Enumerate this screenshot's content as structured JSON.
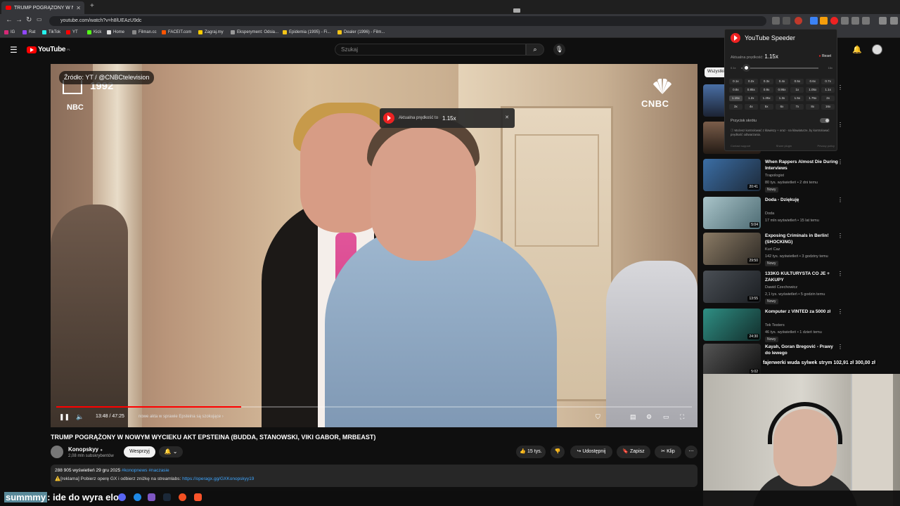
{
  "browser": {
    "tab_title": "TRUMP POGRĄŻONY W NO...",
    "url": "youtube.com/watch?v=h8lUEAzU9dc",
    "bookmarks": [
      {
        "label": "IG",
        "color": "#d62976"
      },
      {
        "label": "Rat",
        "color": "#9146ff"
      },
      {
        "label": "TikTok",
        "color": "#25f4ee"
      },
      {
        "label": "YT",
        "color": "#ff0000"
      },
      {
        "label": "Kick",
        "color": "#53fc18"
      },
      {
        "label": "Home",
        "color": "#dddddd"
      },
      {
        "label": "Filman.cc",
        "color": "#888888"
      },
      {
        "label": "FACEIT.com",
        "color": "#ff5500"
      },
      {
        "label": "Zagraj.my",
        "color": "#ffcc00"
      },
      {
        "label": "Eksperyment: Odsia...",
        "color": "#999999"
      },
      {
        "label": "Epidemia (1995) - Fi...",
        "color": "#f5c518"
      },
      {
        "label": "Dealer (1996) - Film...",
        "color": "#f5c518"
      }
    ]
  },
  "yt_header": {
    "logo": "YouTube",
    "region": "PL",
    "search_placeholder": "Szukaj"
  },
  "video": {
    "source_badge": "Źródło: YT / @CNBCtelevision",
    "year_overlay": "1992",
    "network_left": "NBC",
    "network_right": "CNBC",
    "speed_toast_label": "Aktualna prędkość to",
    "speed_toast_value": "1.15x",
    "time": "13:48 / 47:25",
    "chapter": "nowe akta w sprawie Epsteina są szokujące",
    "progress": 0.291
  },
  "meta": {
    "title": "TRUMP POGRĄŻONY W NOWYM WYCIEKU AKT EPSTEINA (BUDDA, STANOWSKI, VIKI GABOR, MRBEAST)",
    "channel": "Konopskyy",
    "subs": "2,08 mln subskrybentów",
    "support": "Wesprzyj",
    "likes": "15 tys.",
    "share": "Udostępnij",
    "save": "Zapisz",
    "clip": "Klip",
    "views_date": "288 905 wyświetleń  29 gru 2025",
    "hashtags": "#konopnews #naczasie",
    "desc_line": "⚠️[reklama] Pobierz operę GX i odbierz zniżkę na streamlabs:",
    "desc_link": "https://operagx.gg/GXKonopskyy19"
  },
  "sidebar": {
    "chip": "Wszystkie",
    "recs": [
      {
        "title": "When Rappers Almost Die During Interviews",
        "channel": "Trapologist",
        "meta": "80 tys. wyświetleń • 2 dni temu",
        "duration": "20:41",
        "new": "Nowy",
        "color1": "#3b6ea5",
        "color2": "#1d2a3a"
      },
      {
        "title": "Doda - Dziękuję",
        "channel": "Doda",
        "meta": "17 mln wyświetleń • 15 lat temu",
        "duration": "5:04",
        "new": "",
        "color1": "#a9c4c9",
        "color2": "#4d6b73"
      },
      {
        "title": "Exposing Criminals in Berlin! (SHOCKING)",
        "channel": "Kurt Caz",
        "meta": "142 tys. wyświetleń • 3 godziny temu",
        "duration": "29:50",
        "new": "Nowy",
        "color1": "#8b7b65",
        "color2": "#2e2a25"
      },
      {
        "title": "133KG KULTURYSTA CO JE + ZAKUPY",
        "channel": "Dawid Czechowicz",
        "meta": "2,1 tys. wyświetleń • 5 godzin temu",
        "duration": "13:55",
        "new": "Nowy",
        "color1": "#4a4f55",
        "color2": "#1b1e22"
      },
      {
        "title": "Komputer z VINTED za 5000 zł",
        "channel": "Tek Testers",
        "meta": "46 tys. wyświetleń • 1 dzień temu",
        "duration": "24:30",
        "new": "Nowy",
        "color1": "#2f8f84",
        "color2": "#122d2b"
      },
      {
        "title": "Kayah, Goran Bregović - Prawy do lewego",
        "channel": "",
        "meta": "",
        "duration": "5:02",
        "new": "",
        "color1": "#555555",
        "color2": "#111111"
      }
    ]
  },
  "extension": {
    "title": "YouTube Speeder",
    "current_label": "Aktualna prędkość:",
    "current_value": "1.15x",
    "reset": "Reset",
    "min": "0.1x",
    "max": "16x",
    "speed_value": 1.15,
    "presets": [
      "0.1x",
      "0.2x",
      "0.3x",
      "0.4x",
      "0.5x",
      "0.6x",
      "0.7x",
      "0.8x",
      "0.85x",
      "0.9x",
      "0.95x",
      "1x",
      "1.05x",
      "1.1x",
      "1.15x",
      "1.2x",
      "1.25x",
      "1.3x",
      "1.5x",
      "1.75x",
      "2x",
      "3x",
      "4x",
      "5x",
      "6x",
      "7x",
      "8x",
      "16x"
    ],
    "shortcut": "Przycisk skrótu",
    "info": "Możesz kontrolować z klawiszy + oraz - na klawiaturze, by kontrolować prędkość odtwarzania.",
    "links": [
      "Contact support",
      "Share plugin",
      "Privacy policy"
    ]
  },
  "overlay": {
    "chat_user": "summmy",
    "chat_text": ": ide do wyra elo",
    "ticker": "fajerwerki wuda sylwek strym 102,91 zł  300,00 zł"
  }
}
